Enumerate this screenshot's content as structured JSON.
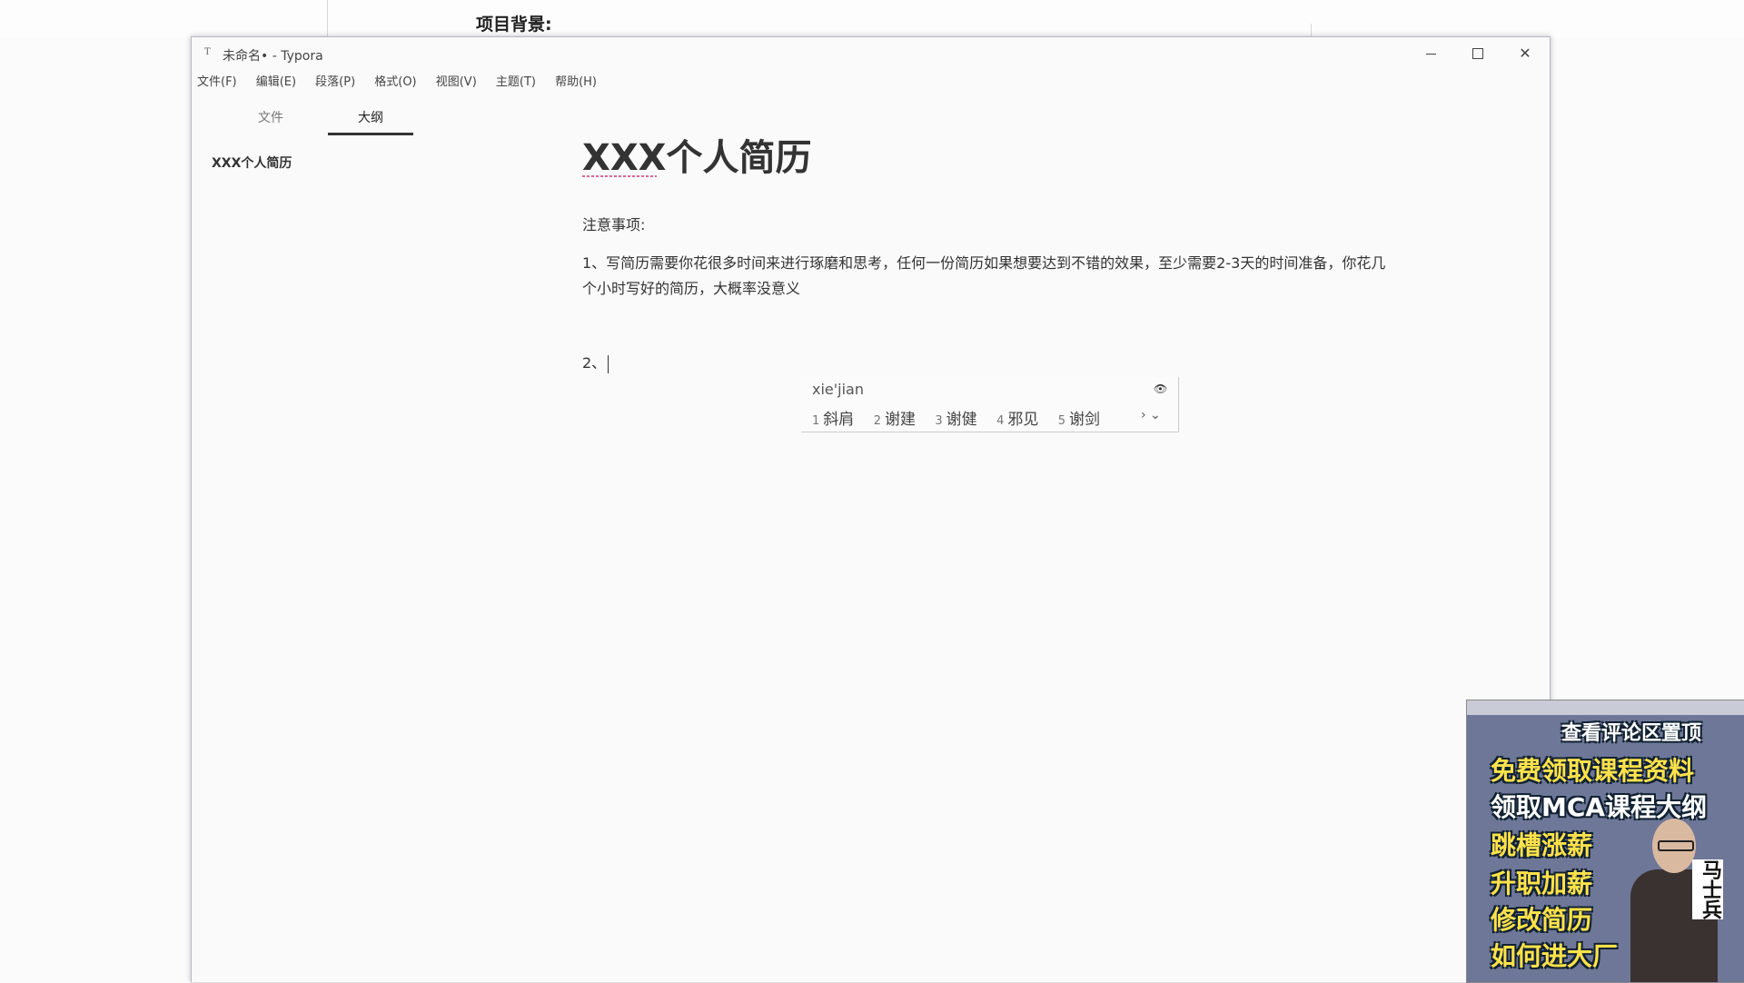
{
  "background_doc": {
    "heading": "项目背景:"
  },
  "window": {
    "title": "未命名• - Typora",
    "icon_glyph": "T",
    "controls": {
      "minimize": "—",
      "maximize": "□",
      "close": "✕"
    }
  },
  "menu": [
    "文件(F)",
    "编辑(E)",
    "段落(P)",
    "格式(O)",
    "视图(V)",
    "主题(T)",
    "帮助(H)"
  ],
  "sidebar": {
    "tabs": [
      {
        "label": "文件",
        "active": false
      },
      {
        "label": "大纲",
        "active": true
      }
    ],
    "outline": [
      "XXX个人简历"
    ]
  },
  "editor": {
    "title": "XXX个人简历",
    "note_label": "注意事项:",
    "item1": "1、写简历需要你花很多时间来进行琢磨和思考，任何一份简历如果想要达到不错的效果，至少需要2-3天的时间准备，你花几个小时写好的简历，大概率没意义",
    "item2_prefix": "2、"
  },
  "ime": {
    "pinyin": "xie'jian",
    "candidates": [
      {
        "num": "1",
        "text": "斜肩"
      },
      {
        "num": "2",
        "text": "谢建"
      },
      {
        "num": "3",
        "text": "谢健"
      },
      {
        "num": "4",
        "text": "邪见"
      },
      {
        "num": "5",
        "text": "谢剑"
      }
    ],
    "nav": "› ⌄",
    "eye_icon": "👁"
  },
  "promo": {
    "line0": "查看评论区置顶",
    "line1": "免费领取课程资料",
    "line2": "领取MCA课程大纲",
    "line3": "跳槽涨薪",
    "line4": "升职加薪",
    "line5": "修改简历",
    "line6": "如何进大厂",
    "side_text": "马士兵"
  }
}
